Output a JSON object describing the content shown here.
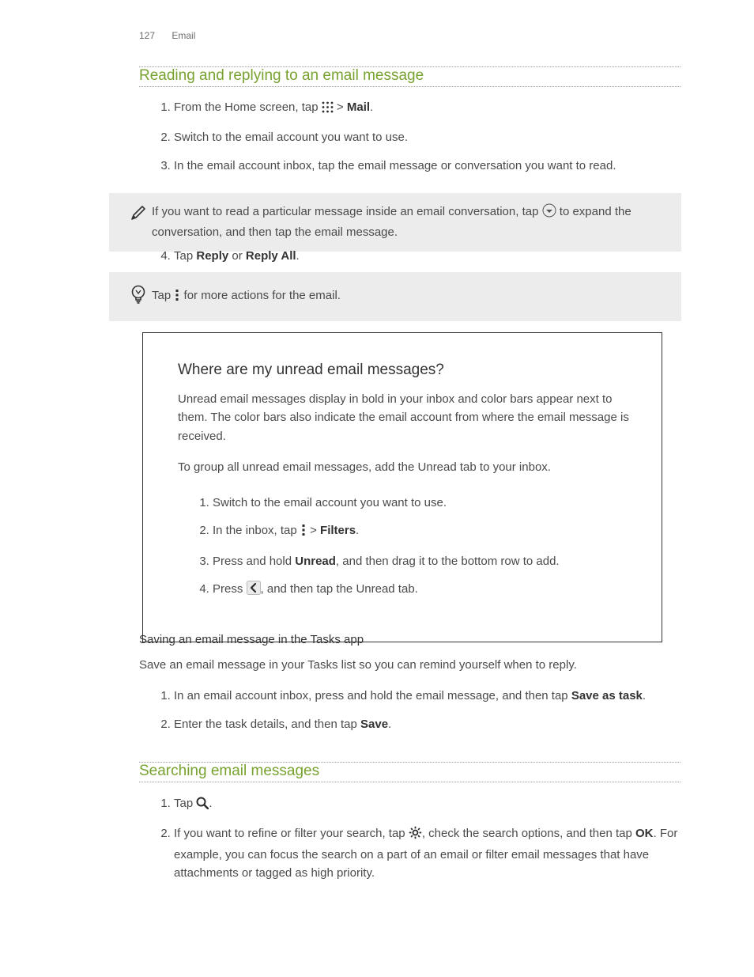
{
  "header": {
    "page": "127",
    "section": "Email"
  },
  "s1": {
    "title": "Reading and replying to an email message",
    "step1_a": "From the Home screen, tap ",
    "step1_b": " > ",
    "step1_mail": "Mail",
    "step1_c": ".",
    "step2": "Switch to the email account you want to use.",
    "step3": "In the email account inbox, tap the email message or conversation you want to read.",
    "note_a": "If you want to read a particular message inside an email conversation, tap ",
    "note_b": " to expand the conversation, and then tap the email message.",
    "step4_a": "Tap ",
    "step4_reply": "Reply",
    "step4_or": " or ",
    "step4_replyall": "Reply All",
    "step4_c": ".",
    "tip_a": "Tap ",
    "tip_b": " for more actions for the email."
  },
  "box": {
    "title": "Where are my unread email messages?",
    "p1": "Unread email messages display in bold in your inbox and color bars appear next to them. The color bars also indicate the email account from where the email message is received.",
    "p2": "To group all unread email messages, add the Unread tab to your inbox.",
    "step1": "Switch to the email account you want to use.",
    "step2_a": "In the inbox, tap ",
    "step2_b": " > ",
    "step2_filters": "Filters",
    "step2_c": ".",
    "step3_a": "Press and hold ",
    "step3_unread": "Unread",
    "step3_b": ", and then drag it to the bottom row to add.",
    "step4_a": "Press ",
    "step4_b": ", and then tap the Unread tab."
  },
  "s2": {
    "title": "Saving an email message in the Tasks app",
    "p": "Save an email message in your Tasks list so you can remind yourself when to reply.",
    "step1_a": "In an email account inbox, press and hold the email message, and then tap ",
    "step1_save": "Save as task",
    "step1_b": ".",
    "step2_a": "Enter the task details, and then tap ",
    "step2_save": "Save",
    "step2_b": "."
  },
  "s3": {
    "title": "Searching email messages",
    "step1_a": "Tap ",
    "step1_b": ".",
    "step2_a": "If you want to refine or filter your search, tap ",
    "step2_b": ", check the search options, and then tap ",
    "step2_ok": "OK",
    "step2_c": ". For example, you can focus the search on a part of an email or filter email messages that have attachments or tagged as high priority."
  }
}
